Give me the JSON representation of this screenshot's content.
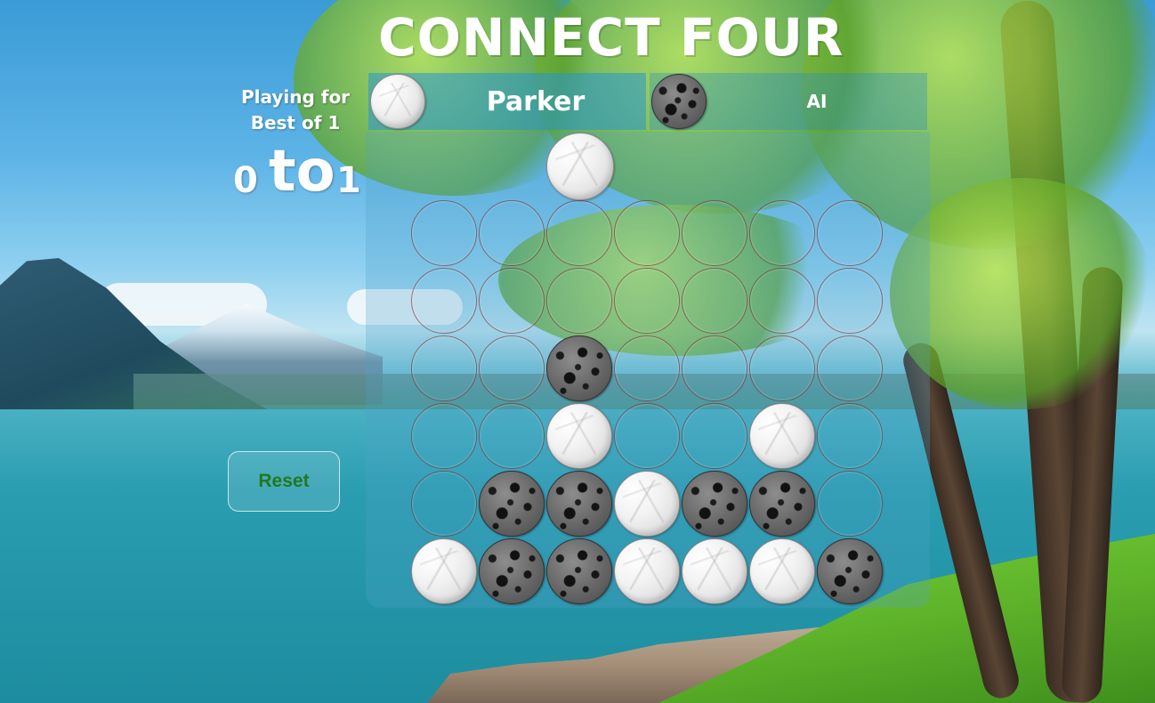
{
  "title": "CONNECT FOUR",
  "score_panel": {
    "playing_for_line1": "Playing for",
    "playing_for_line2": "Best of 1",
    "player1_score": "0",
    "separator": "to",
    "player2_score": "1"
  },
  "reset_label": "Reset",
  "players": [
    {
      "name": "Parker",
      "token": "white",
      "active": true
    },
    {
      "name": "AI",
      "token": "black",
      "active": false
    }
  ],
  "hover_piece": {
    "color": "white",
    "column": 2
  },
  "board": {
    "columns": 7,
    "rows": 6,
    "cells": [
      [
        "",
        "",
        "",
        "",
        "",
        "",
        ""
      ],
      [
        "",
        "",
        "",
        "",
        "",
        "",
        ""
      ],
      [
        "",
        "",
        "B",
        "",
        "",
        "",
        ""
      ],
      [
        "",
        "",
        "W",
        "",
        "",
        "W",
        ""
      ],
      [
        "",
        "B",
        "B",
        "W",
        "B",
        "B",
        ""
      ],
      [
        "W",
        "B",
        "B",
        "W",
        "W",
        "W",
        "B"
      ]
    ]
  },
  "colors": {
    "reset_text": "#1f7a1f",
    "title": "#ffffff"
  }
}
